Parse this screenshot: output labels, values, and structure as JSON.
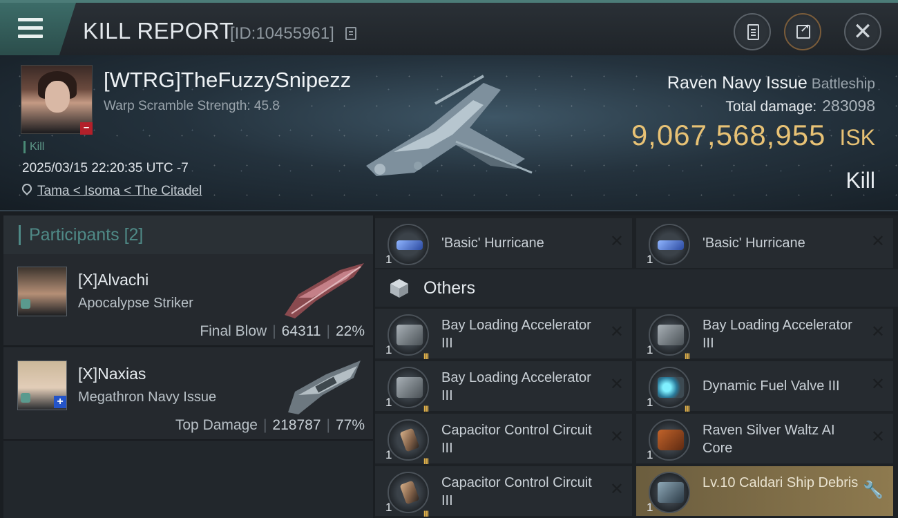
{
  "header": {
    "title": "KILL REPORT",
    "id_text": "[ID:10455961]",
    "menu_icon": "hamburger-menu-icon",
    "buttons": [
      {
        "name": "clipboard",
        "icon": "clipboard-icon"
      },
      {
        "name": "share",
        "icon": "share-icon"
      },
      {
        "name": "close",
        "icon": "close-icon",
        "glyph": "✕"
      }
    ]
  },
  "victim": {
    "pilot": "[WTRG]TheFuzzySnipezz",
    "warp_scramble": "Warp Scramble Strength: 45.8",
    "kill_tag": "Kill",
    "datetime": "2025/03/15 22:20:35 UTC -7",
    "location": "Tama < Isoma < The Citadel",
    "minus_badge": "–"
  },
  "loss": {
    "ship": "Raven Navy Issue",
    "ship_class": "Battleship",
    "total_damage_label": "Total damage:",
    "total_damage": "283098",
    "isk_value": "9,067,568,955",
    "isk_unit": "ISK",
    "result": "Kill"
  },
  "participants": {
    "title": "Participants",
    "count": "[2]",
    "rows": [
      {
        "name": "[X]Alvachi",
        "ship": "Apocalypse Striker",
        "role": "Final Blow",
        "damage": "64311",
        "percent": "22%"
      },
      {
        "name": "[X]Naxias",
        "ship": "Megathron Navy Issue",
        "role": "Top Damage",
        "damage": "218787",
        "percent": "77%",
        "badge": "+"
      }
    ]
  },
  "items": {
    "others_label": "Others",
    "close_glyph": "✕",
    "wrench_glyph": "🔧",
    "meta_tag": "III",
    "top_row": [
      {
        "name": "'Basic' Hurricane",
        "qty": "1",
        "icon": "hurricane-drone-icon"
      },
      {
        "name": "'Basic' Hurricane",
        "qty": "1",
        "icon": "hurricane-drone-icon"
      }
    ],
    "grid": [
      {
        "name": "Bay Loading Accelerator III",
        "qty": "1",
        "icon": "launcher-module-icon"
      },
      {
        "name": "Bay Loading Accelerator III",
        "qty": "1",
        "icon": "launcher-module-icon"
      },
      {
        "name": "Bay Loading Accelerator III",
        "qty": "1",
        "icon": "launcher-module-icon"
      },
      {
        "name": "Dynamic Fuel Valve III",
        "qty": "1",
        "icon": "fuel-valve-icon"
      },
      {
        "name": "Capacitor Control Circuit III",
        "qty": "1",
        "icon": "capacitor-rig-icon"
      },
      {
        "name": "Raven Silver Waltz AI Core",
        "qty": "1",
        "icon": "ai-core-icon"
      },
      {
        "name": "Capacitor Control Circuit III",
        "qty": "1",
        "icon": "capacitor-rig-icon"
      },
      {
        "name": "Lv.10 Caldari Ship Debris",
        "qty": "1",
        "icon": "ship-debris-icon"
      }
    ]
  },
  "colors": {
    "accent_teal": "#4f8a87",
    "isk_gold": "#e8c275",
    "danger_red": "#b3202a",
    "highlight_gold": "#8e7a4f"
  }
}
